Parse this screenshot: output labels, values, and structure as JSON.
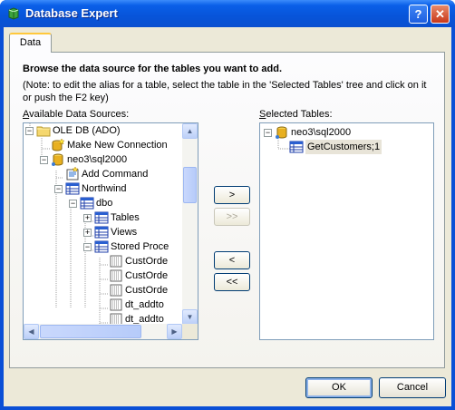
{
  "window": {
    "title": "Database Expert",
    "help_label": "?",
    "close_label": "✕"
  },
  "tabs": [
    {
      "label": "Data",
      "active": true
    }
  ],
  "instructions": {
    "heading": "Browse the data source for the tables you want to add.",
    "note": "(Note: to edit the alias for a table, select the table in the 'Selected Tables' tree and click on it or push the F2 key)"
  },
  "available": {
    "label_prefix": "A",
    "label_rest": "vailable Data Sources:",
    "tree": [
      {
        "label": "OLE DB (ADO)",
        "icon": "folder-icon",
        "expander": "-"
      },
      {
        "label": "Make New Connection",
        "icon": "new-connection-icon",
        "expander": ""
      },
      {
        "label": "neo3\\sql2000",
        "icon": "database-server-icon",
        "expander": "-"
      },
      {
        "label": "Add Command",
        "icon": "add-command-icon",
        "expander": ""
      },
      {
        "label": "Northwind",
        "icon": "database-icon",
        "expander": "-"
      },
      {
        "label": "dbo",
        "icon": "schema-icon",
        "expander": "-"
      },
      {
        "label": "Tables",
        "icon": "tables-folder-icon",
        "expander": "+"
      },
      {
        "label": "Views",
        "icon": "views-folder-icon",
        "expander": "+"
      },
      {
        "label": "Stored Proce",
        "icon": "stored-procedures-icon",
        "expander": "-"
      },
      {
        "label": "CustOrde",
        "icon": "stored-procedure-icon",
        "expander": ""
      },
      {
        "label": "CustOrde",
        "icon": "stored-procedure-icon",
        "expander": ""
      },
      {
        "label": "CustOrde",
        "icon": "stored-procedure-icon",
        "expander": ""
      },
      {
        "label": "dt_addto",
        "icon": "stored-procedure-icon",
        "expander": ""
      },
      {
        "label": "dt_addto",
        "icon": "stored-procedure-icon",
        "expander": ""
      }
    ]
  },
  "selected": {
    "label_prefix": "S",
    "label_rest": "elected Tables:",
    "tree": [
      {
        "label": "neo3\\sql2000",
        "icon": "database-server-icon",
        "expander": "-"
      },
      {
        "label": "GetCustomers;1",
        "icon": "table-icon",
        "expander": ""
      }
    ]
  },
  "move_buttons": {
    "add": ">",
    "add_all": ">>",
    "remove": "<",
    "remove_all": "<<"
  },
  "footer": {
    "ok": "OK",
    "cancel": "Cancel"
  },
  "colors": {
    "titlebar": "#0a5fe8",
    "dialog_face": "#ece9d8",
    "tab_highlight": "#ffc83c"
  }
}
